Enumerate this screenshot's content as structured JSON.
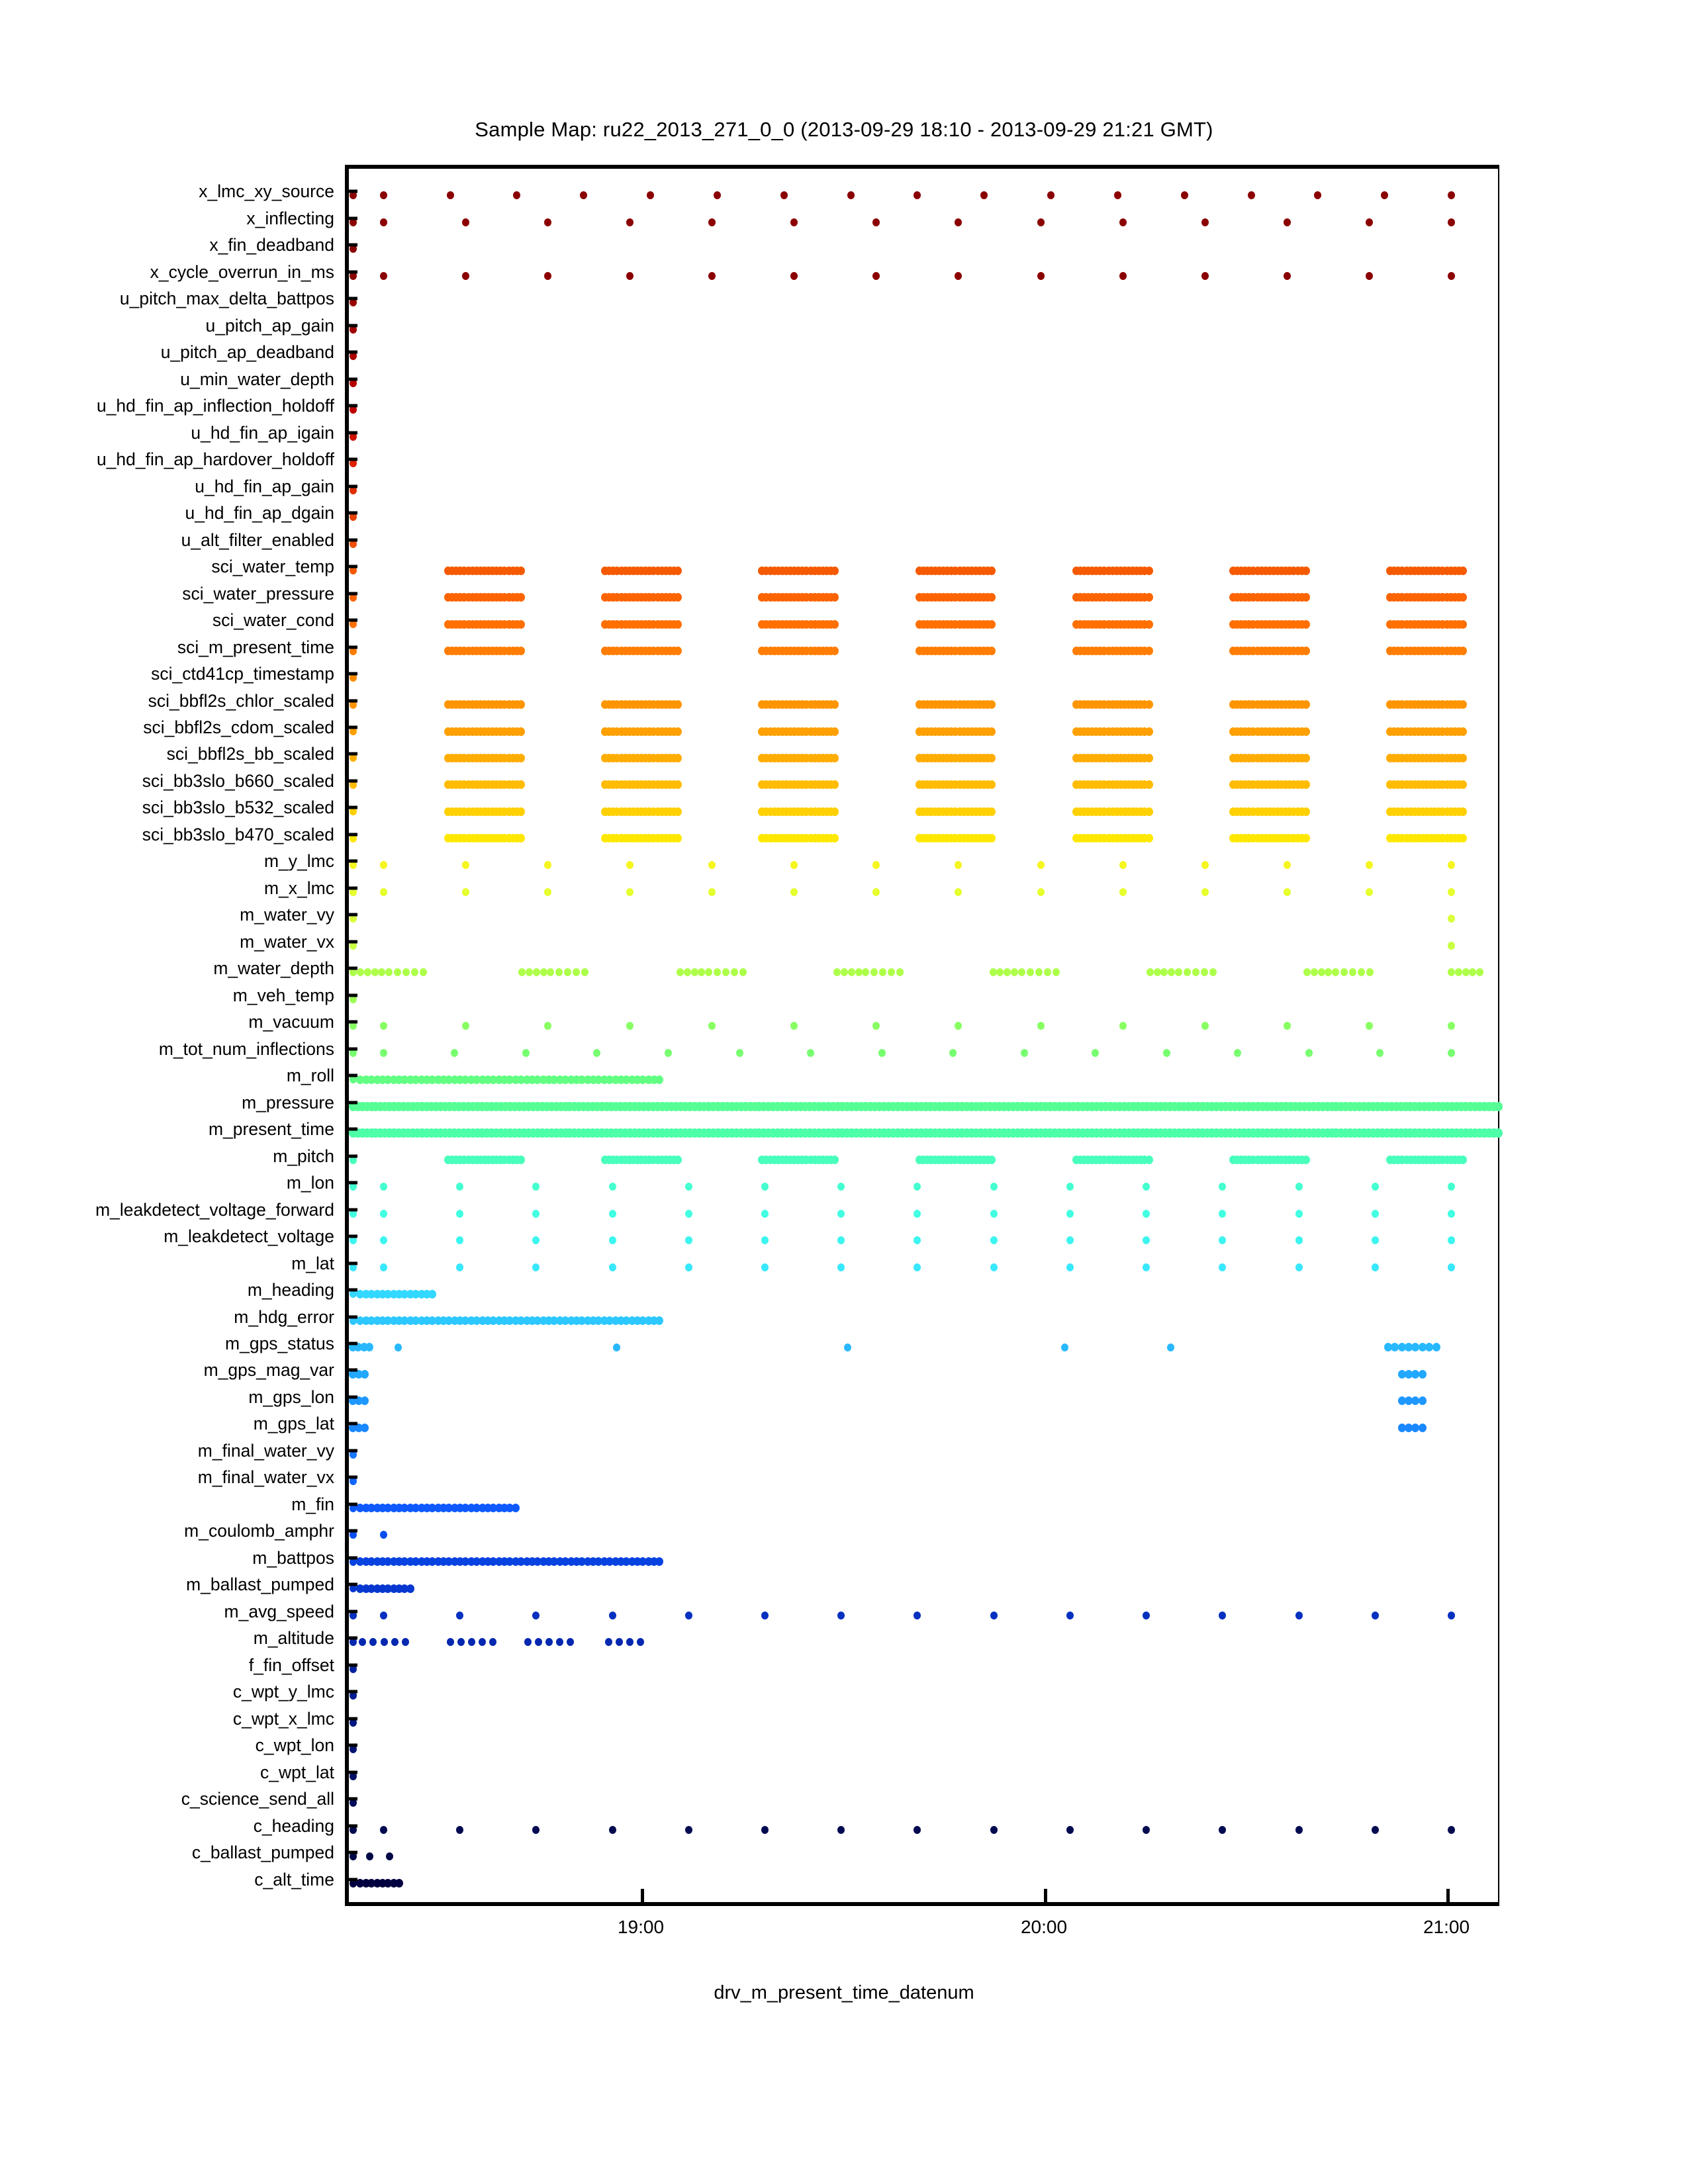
{
  "chart_data": {
    "type": "scatter",
    "title": "Sample Map: ru22_2013_271_0_0 (2013-09-29 18:10 - 2013-09-29 21:21 GMT)",
    "xlabel": "drv_m_present_time_datenum",
    "ylabel": "",
    "grid": false,
    "legend": false,
    "xtick_labels": [
      "19:00",
      "20:00",
      "21:00"
    ],
    "xtick_positions": [
      968,
      1577,
      2185
    ],
    "x_range_label": "2013-09-29 18:10 - 2013-09-29 21:21 GMT",
    "description": "Glider sensor availability map: each row is a sensor variable, each marker is a time at which that sensor reported a value. Marker color varies by row from dark red at top to dark blue at bottom (reversed jet colormap).",
    "categories": [
      "x_lmc_xy_source",
      "x_inflecting",
      "x_fin_deadband",
      "x_cycle_overrun_in_ms",
      "u_pitch_max_delta_battpos",
      "u_pitch_ap_gain",
      "u_pitch_ap_deadband",
      "u_min_water_depth",
      "u_hd_fin_ap_inflection_holdoff",
      "u_hd_fin_ap_igain",
      "u_hd_fin_ap_hardover_holdoff",
      "u_hd_fin_ap_gain",
      "u_hd_fin_ap_dgain",
      "u_alt_filter_enabled",
      "sci_water_temp",
      "sci_water_pressure",
      "sci_water_cond",
      "sci_m_present_time",
      "sci_ctd41cp_timestamp",
      "sci_bbfl2s_chlor_scaled",
      "sci_bbfl2s_cdom_scaled",
      "sci_bbfl2s_bb_scaled",
      "sci_bb3slo_b660_scaled",
      "sci_bb3slo_b532_scaled",
      "sci_bb3slo_b470_scaled",
      "m_y_lmc",
      "m_x_lmc",
      "m_water_vy",
      "m_water_vx",
      "m_water_depth",
      "m_veh_temp",
      "m_vacuum",
      "m_tot_num_inflections",
      "m_roll",
      "m_pressure",
      "m_present_time",
      "m_pitch",
      "m_lon",
      "m_leakdetect_voltage_forward",
      "m_leakdetect_voltage",
      "m_lat",
      "m_heading",
      "m_hdg_error",
      "m_gps_status",
      "m_gps_mag_var",
      "m_gps_lon",
      "m_gps_lat",
      "m_final_water_vy",
      "m_final_water_vx",
      "m_fin",
      "m_coulomb_amphr",
      "m_battpos",
      "m_ballast_pumped",
      "m_avg_speed",
      "m_altitude",
      "f_fin_offset",
      "c_wpt_y_lmc",
      "c_wpt_x_lmc",
      "c_wpt_lon",
      "c_wpt_lat",
      "c_science_send_all",
      "c_heading",
      "c_ballast_pumped",
      "c_alt_time"
    ],
    "row_colors": [
      "#8B0000",
      "#8B0000",
      "#8B0000",
      "#8B0000",
      "#990000",
      "#A00000",
      "#AA0000",
      "#B40000",
      "#BF0000",
      "#CC1100",
      "#DD2200",
      "#E03000",
      "#E84000",
      "#F05000",
      "#F55A00",
      "#FB6400",
      "#FF7000",
      "#FF7D00",
      "#FF8A00",
      "#FF9500",
      "#FFA000",
      "#FFAD00",
      "#FFBC00",
      "#FFD000",
      "#FFE800",
      "#F5F520",
      "#E6FF2E",
      "#D8FF3A",
      "#C8FF42",
      "#AEFF4A",
      "#9CFF55",
      "#88FF62",
      "#78FF70",
      "#62FF82",
      "#55FF95",
      "#4DFFA8",
      "#48FFBC",
      "#45FFD0",
      "#42FFE2",
      "#3DF5F0",
      "#38E8FF",
      "#32D8FF",
      "#2DC8FF",
      "#28B8FF",
      "#22A8FF",
      "#1E98FF",
      "#1A88FF",
      "#1678FF",
      "#1268FF",
      "#0E5AFF",
      "#0B4EF0",
      "#0842E0",
      "#0638D0",
      "#0530C0",
      "#0428B0",
      "#0322A0",
      "#021C90",
      "#021880",
      "#011472",
      "#011066",
      "#010C5A",
      "#000A50",
      "#000848",
      "#000040"
    ],
    "row_patterns": [
      {
        "row": 0,
        "kind": "sparse",
        "n": 17,
        "note": "dark red dots spaced ~12 min plus dense cluster at right edge"
      },
      {
        "row": 1,
        "kind": "sparse",
        "n": 14
      },
      {
        "row": 2,
        "kind": "single-left",
        "n": 1
      },
      {
        "row": 3,
        "kind": "sparse",
        "n": 14
      },
      {
        "row": 4,
        "kind": "single-left",
        "n": 1
      },
      {
        "row": 5,
        "kind": "single-left",
        "n": 1
      },
      {
        "row": 6,
        "kind": "single-left",
        "n": 1
      },
      {
        "row": 7,
        "kind": "single-left",
        "n": 1
      },
      {
        "row": 8,
        "kind": "single-left",
        "n": 1
      },
      {
        "row": 9,
        "kind": "single-left",
        "n": 1
      },
      {
        "row": 10,
        "kind": "single-left",
        "n": 1
      },
      {
        "row": 11,
        "kind": "single-left",
        "n": 1
      },
      {
        "row": 12,
        "kind": "single-left",
        "n": 1
      },
      {
        "row": 13,
        "kind": "single-left",
        "n": 1
      },
      {
        "row": 14,
        "kind": "segments",
        "n": 7,
        "note": "seven solid science-on segments"
      },
      {
        "row": 15,
        "kind": "segments",
        "n": 7
      },
      {
        "row": 16,
        "kind": "segments",
        "n": 7
      },
      {
        "row": 17,
        "kind": "segments",
        "n": 7
      },
      {
        "row": 18,
        "kind": "single-left",
        "n": 1
      },
      {
        "row": 19,
        "kind": "segments",
        "n": 7
      },
      {
        "row": 20,
        "kind": "segments",
        "n": 7
      },
      {
        "row": 21,
        "kind": "segments",
        "n": 7
      },
      {
        "row": 22,
        "kind": "segments",
        "n": 7
      },
      {
        "row": 23,
        "kind": "segments",
        "n": 7
      },
      {
        "row": 24,
        "kind": "segments",
        "n": 7
      },
      {
        "row": 25,
        "kind": "sparse",
        "n": 14
      },
      {
        "row": 26,
        "kind": "sparse",
        "n": 14
      },
      {
        "row": 27,
        "kind": "edges",
        "n": 2
      },
      {
        "row": 28,
        "kind": "edges",
        "n": 2
      },
      {
        "row": 29,
        "kind": "clusters",
        "n": 8,
        "note": "burst of samples at each surfacing/inflection"
      },
      {
        "row": 30,
        "kind": "single-left",
        "n": 1
      },
      {
        "row": 31,
        "kind": "sparse",
        "n": 14
      },
      {
        "row": 32,
        "kind": "sparse",
        "n": 16
      },
      {
        "row": 33,
        "kind": "dense-run",
        "end": 0.27
      },
      {
        "row": 34,
        "kind": "dense-full"
      },
      {
        "row": 35,
        "kind": "dense-full"
      },
      {
        "row": 36,
        "kind": "segments",
        "n": 7
      },
      {
        "row": 37,
        "kind": "sparse",
        "n": 15
      },
      {
        "row": 38,
        "kind": "sparse",
        "n": 15
      },
      {
        "row": 39,
        "kind": "sparse",
        "n": 15
      },
      {
        "row": 40,
        "kind": "sparse",
        "n": 15
      },
      {
        "row": 41,
        "kind": "dense-run",
        "end": 0.075
      },
      {
        "row": 42,
        "kind": "dense-run",
        "end": 0.27
      },
      {
        "row": 43,
        "kind": "gps",
        "n": 6
      },
      {
        "row": 44,
        "kind": "gps-edge"
      },
      {
        "row": 45,
        "kind": "gps-edge"
      },
      {
        "row": 46,
        "kind": "gps-edge"
      },
      {
        "row": 47,
        "kind": "single-left",
        "n": 1
      },
      {
        "row": 48,
        "kind": "single-left",
        "n": 1
      },
      {
        "row": 49,
        "kind": "dense-run",
        "end": 0.145
      },
      {
        "row": 50,
        "kind": "single-dot",
        "n": 1
      },
      {
        "row": 51,
        "kind": "dense-run",
        "end": 0.27
      },
      {
        "row": 52,
        "kind": "dense-run",
        "end": 0.055
      },
      {
        "row": 53,
        "kind": "sparse",
        "n": 15
      },
      {
        "row": 54,
        "kind": "altitude",
        "n": 4
      },
      {
        "row": 55,
        "kind": "single-left",
        "n": 1
      },
      {
        "row": 56,
        "kind": "single-left",
        "n": 1
      },
      {
        "row": 57,
        "kind": "single-left",
        "n": 1
      },
      {
        "row": 58,
        "kind": "single-left",
        "n": 1
      },
      {
        "row": 59,
        "kind": "single-left",
        "n": 1
      },
      {
        "row": 60,
        "kind": "single-left",
        "n": 1
      },
      {
        "row": 61,
        "kind": "sparse",
        "n": 15
      },
      {
        "row": 62,
        "kind": "tiny",
        "n": 2
      },
      {
        "row": 63,
        "kind": "dense-run",
        "end": 0.045
      }
    ]
  }
}
